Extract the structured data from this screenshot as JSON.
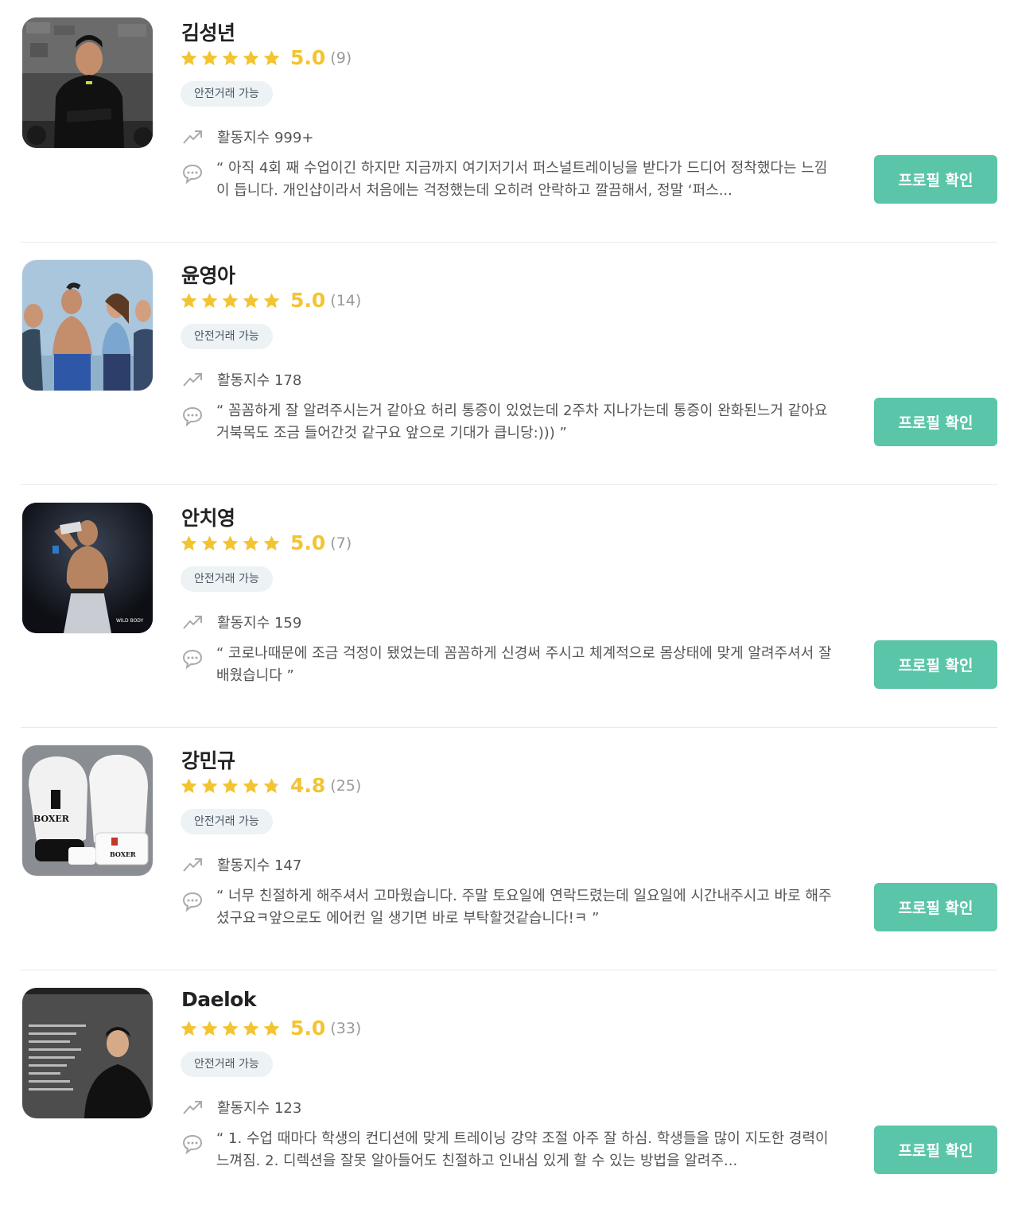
{
  "colors": {
    "accent": "#5ac5a8",
    "star": "#f3c431",
    "badge_bg": "#edf2f5"
  },
  "icons": {
    "star": "star-icon",
    "trend": "trend-up-icon",
    "review": "speech-bubble-icon"
  },
  "trainers": [
    {
      "name": "김성년",
      "score": "5.0",
      "review_count": "(9)",
      "stars": 5,
      "badge": "안전거래 가능",
      "activity": "활동지수 999+",
      "review": "“ 아직 4회 째 수업이긴 하지만 지금까지 여기저기서 퍼스널트레이닝을 받다가 드디어 정착했다는 느낌이 듭니다. 개인샵이라서 처음에는 걱정했는데 오히려 안락하고 깔끔해서, 정말 ‘퍼스...",
      "button": "프로필 확인"
    },
    {
      "name": "윤영아",
      "score": "5.0",
      "review_count": "(14)",
      "stars": 5,
      "badge": "안전거래 가능",
      "activity": "활동지수 178",
      "review": "“ 꼼꼼하게 잘 알려주시는거 같아요 허리 통증이 있었는데 2주차 지나가는데 통증이 완화된느거 같아요 거북목도 조금 들어간것 같구요 앞으로 기대가 큽니당:))) ”",
      "button": "프로필 확인"
    },
    {
      "name": "안치영",
      "score": "5.0",
      "review_count": "(7)",
      "stars": 5,
      "badge": "안전거래 가능",
      "activity": "활동지수 159",
      "review": "“ 코로나때문에 조금 걱정이 됐었는데 꼼꼼하게 신경써 주시고 체계적으로 몸상태에 맞게 알려주셔서 잘 배웠습니다 ”",
      "button": "프로필 확인"
    },
    {
      "name": "강민규",
      "score": "4.8",
      "review_count": "(25)",
      "stars": 4.8,
      "badge": "안전거래 가능",
      "activity": "활동지수 147",
      "review": "“ 너무 친절하게 해주셔서 고마웠습니다. 주말 토요일에 연락드렸는데 일요일에 시간내주시고 바로 해주셨구요ㅋ앞으로도 에어컨 일 생기면 바로 부탁할것같습니다!ㅋ ”",
      "button": "프로필 확인"
    },
    {
      "name": "Daelok",
      "score": "5.0",
      "review_count": "(33)",
      "stars": 5,
      "badge": "안전거래 가능",
      "activity": "활동지수 123",
      "review": "“ 1. 수업 때마다 학생의 컨디션에 맞게 트레이닝 강약 조절 아주 잘 하심. 학생들을 많이 지도한 경력이 느껴짐. 2. 디렉션을 잘못 알아들어도 친절하고 인내심 있게 할 수 있는 방법을 알려주...",
      "button": "프로필 확인"
    }
  ]
}
